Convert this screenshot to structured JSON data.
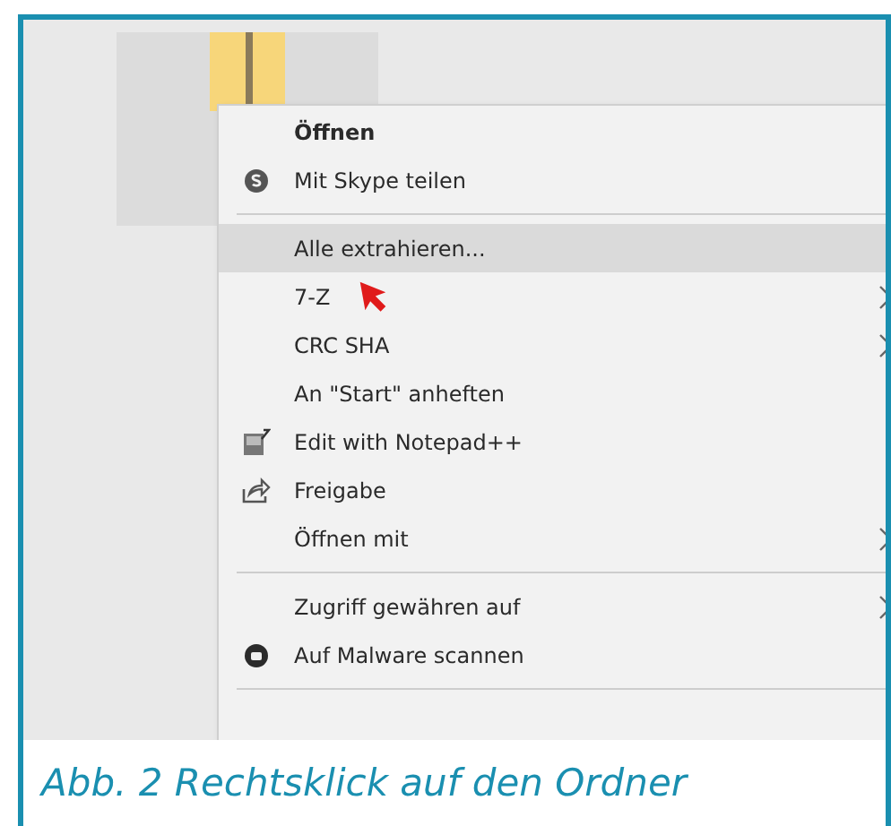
{
  "context_menu": {
    "items": [
      {
        "kind": "plain",
        "label": "Öffnen",
        "bold": true,
        "selected": false,
        "submenu": false
      },
      {
        "kind": "skype",
        "label": "Mit Skype teilen",
        "bold": false,
        "selected": false,
        "submenu": false
      },
      {
        "kind": "separator"
      },
      {
        "kind": "plain",
        "label": "Alle extrahieren...",
        "bold": false,
        "selected": true,
        "submenu": false
      },
      {
        "kind": "plain",
        "label": "7-Z",
        "bold": false,
        "selected": false,
        "submenu": true
      },
      {
        "kind": "plain",
        "label": "CRC SHA",
        "bold": false,
        "selected": false,
        "submenu": true
      },
      {
        "kind": "plain",
        "label": "An \"Start\" anheften",
        "bold": false,
        "selected": false,
        "submenu": false
      },
      {
        "kind": "notepad",
        "label": "Edit with Notepad++",
        "bold": false,
        "selected": false,
        "submenu": false
      },
      {
        "kind": "share",
        "label": "Freigabe",
        "bold": false,
        "selected": false,
        "submenu": false
      },
      {
        "kind": "plain",
        "label": "Öffnen mit",
        "bold": false,
        "selected": false,
        "submenu": true
      },
      {
        "kind": "separator"
      },
      {
        "kind": "plain",
        "label": "Zugriff gewähren auf",
        "bold": false,
        "selected": false,
        "submenu": true
      },
      {
        "kind": "malware",
        "label": "Auf Malware scannen",
        "bold": false,
        "selected": false,
        "submenu": false
      },
      {
        "kind": "separator"
      }
    ]
  },
  "caption": "Abb. 2 Rechtsklick auf den Ordner"
}
